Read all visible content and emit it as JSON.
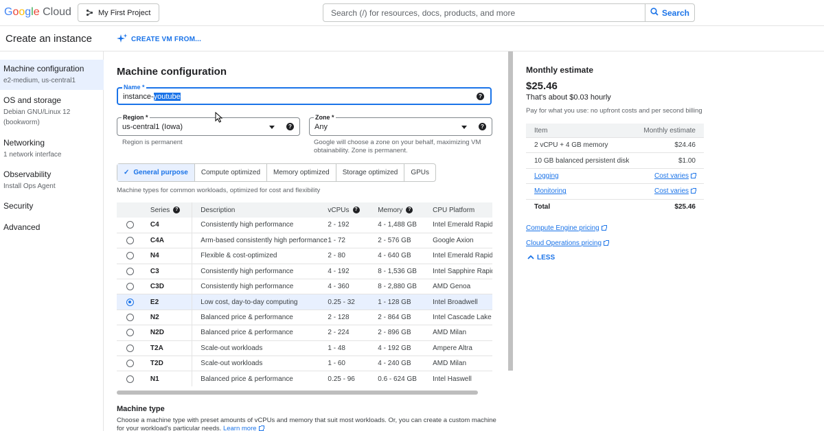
{
  "app": {
    "logo": {
      "g": "G",
      "o1": "o",
      "o2": "o",
      "g2": "g",
      "l": "l",
      "e": "e",
      "cloud": "Cloud"
    },
    "project_label": "My First Project",
    "search_placeholder": "Search (/) for resources, docs, products, and more",
    "search_button": "Search"
  },
  "header": {
    "page_title": "Create an instance",
    "create_vm_label": "CREATE VM FROM..."
  },
  "sidebar": {
    "items": [
      {
        "label": "Machine configuration",
        "sub": "e2-medium, us-central1",
        "active": true
      },
      {
        "label": "OS and storage",
        "sub": "Debian GNU/Linux 12 (bookworm)"
      },
      {
        "label": "Networking",
        "sub": "1 network interface"
      },
      {
        "label": "Observability",
        "sub": "Install Ops Agent"
      },
      {
        "label": "Security",
        "sub": ""
      },
      {
        "label": "Advanced",
        "sub": ""
      }
    ]
  },
  "main": {
    "title": "Machine configuration",
    "name_label": "Name *",
    "name_value_prefix": "instance-",
    "name_value_selected": "youtube",
    "region_label": "Region *",
    "region_value": "us-central1 (Iowa)",
    "region_hint": "Region is permanent",
    "zone_label": "Zone *",
    "zone_value": "Any",
    "zone_hint_1": "Google will choose a zone on your behalf, maximizing VM",
    "zone_hint_2": "obtainability. Zone is permanent.",
    "tabs": [
      "General purpose",
      "Compute optimized",
      "Memory optimized",
      "Storage optimized",
      "GPUs"
    ],
    "tabs_hint": "Machine types for common workloads, optimized for cost and flexibility",
    "table": {
      "headers": {
        "series": "Series",
        "description": "Description",
        "vcpus": "vCPUs",
        "memory": "Memory",
        "cpu": "CPU Platform"
      },
      "rows": [
        {
          "series": "C4",
          "description": "Consistently high performance",
          "vcpus": "2 - 192",
          "memory": "4 - 1,488 GB",
          "cpu": "Intel Emerald Rapids"
        },
        {
          "series": "C4A",
          "description": "Arm-based consistently high performance",
          "vcpus": "1 - 72",
          "memory": "2 - 576 GB",
          "cpu": "Google Axion"
        },
        {
          "series": "N4",
          "description": "Flexible & cost-optimized",
          "vcpus": "2 - 80",
          "memory": "4 - 640 GB",
          "cpu": "Intel Emerald Rapids"
        },
        {
          "series": "C3",
          "description": "Consistently high performance",
          "vcpus": "4 - 192",
          "memory": "8 - 1,536 GB",
          "cpu": "Intel Sapphire Rapids"
        },
        {
          "series": "C3D",
          "description": "Consistently high performance",
          "vcpus": "4 - 360",
          "memory": "8 - 2,880 GB",
          "cpu": "AMD Genoa"
        },
        {
          "series": "E2",
          "description": "Low cost, day-to-day computing",
          "vcpus": "0.25 - 32",
          "memory": "1 - 128 GB",
          "cpu": "Intel Broadwell",
          "selected": true
        },
        {
          "series": "N2",
          "description": "Balanced price & performance",
          "vcpus": "2 - 128",
          "memory": "2 - 864 GB",
          "cpu": "Intel Cascade Lake"
        },
        {
          "series": "N2D",
          "description": "Balanced price & performance",
          "vcpus": "2 - 224",
          "memory": "2 - 896 GB",
          "cpu": "AMD Milan"
        },
        {
          "series": "T2A",
          "description": "Scale-out workloads",
          "vcpus": "1 - 48",
          "memory": "4 - 192 GB",
          "cpu": "Ampere Altra"
        },
        {
          "series": "T2D",
          "description": "Scale-out workloads",
          "vcpus": "1 - 60",
          "memory": "4 - 240 GB",
          "cpu": "AMD Milan"
        },
        {
          "series": "N1",
          "description": "Balanced price & performance",
          "vcpus": "0.25 - 96",
          "memory": "0.6 - 624 GB",
          "cpu": "Intel Haswell"
        }
      ]
    },
    "machine_type_title": "Machine type",
    "machine_type_desc": "Choose a machine type with preset amounts of vCPUs and memory that suit most workloads. Or, you can create a custom machine for your workload's particular needs.",
    "learn_more": "Learn more"
  },
  "estimate": {
    "title": "Monthly estimate",
    "price": "$25.46",
    "hourly": "That's about $0.03 hourly",
    "note": "Pay for what you use: no upfront costs and per second billing",
    "headers": {
      "item": "Item",
      "estimate": "Monthly estimate"
    },
    "rows": [
      {
        "item": "2 vCPU + 4 GB memory",
        "value": "$24.46"
      },
      {
        "item": "10 GB balanced persistent disk",
        "value": "$1.00"
      },
      {
        "item": "Logging",
        "value": "Cost varies",
        "link": true
      },
      {
        "item": "Monitoring",
        "value": "Cost varies",
        "link": true
      },
      {
        "item": "Total",
        "value": "$25.46",
        "total": true
      }
    ],
    "links": [
      "Compute Engine pricing",
      "Cloud Operations pricing"
    ],
    "less_label": "LESS"
  },
  "colors": {
    "accent": "#1a73e8",
    "selected_bg": "#e8f0fe"
  }
}
